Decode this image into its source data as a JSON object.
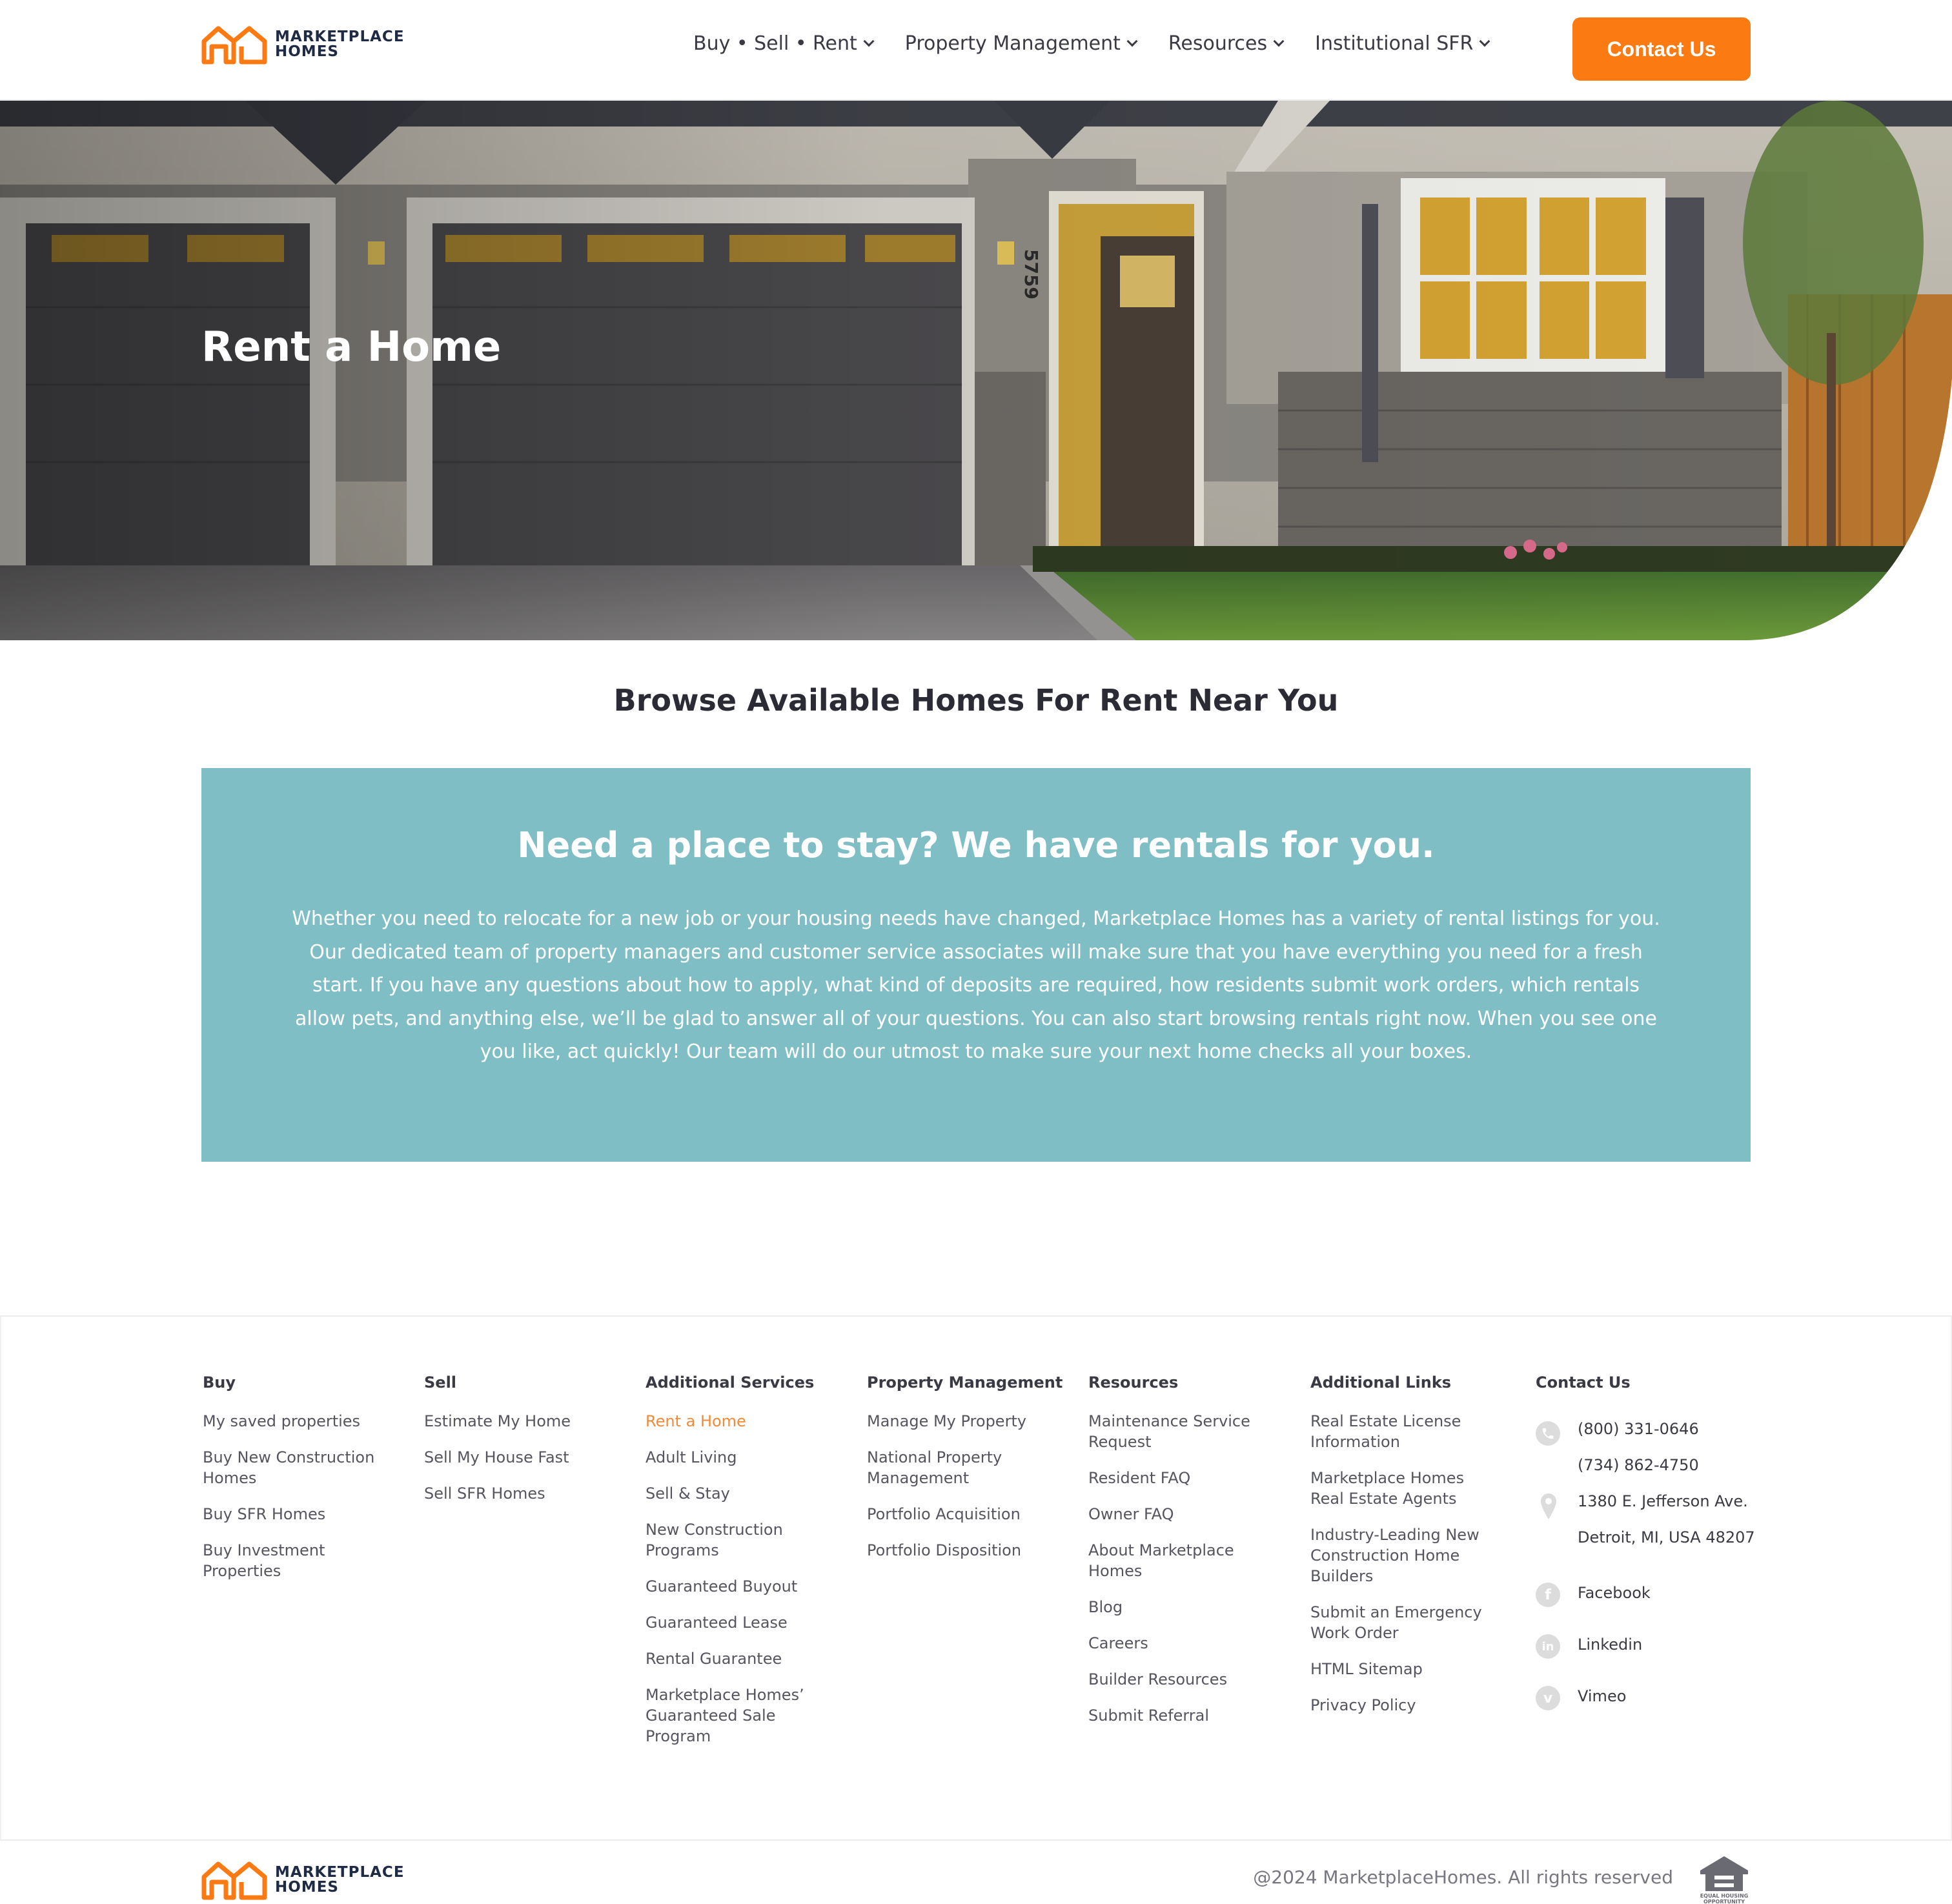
{
  "brand": {
    "line1": "MARKETPLACE",
    "line2": "HOMES",
    "accent": "#fb7a12",
    "navy": "#1f2a44"
  },
  "nav": {
    "items": [
      {
        "label": "Buy • Sell • Rent"
      },
      {
        "label": "Property Management"
      },
      {
        "label": "Resources"
      },
      {
        "label": "Institutional SFR"
      }
    ],
    "cta": "Contact Us"
  },
  "hero": {
    "title": "Rent a Home",
    "house_number": "5759"
  },
  "section": {
    "title": "Browse Available Homes For Rent Near You",
    "box_color": "#7fbec5",
    "box_heading": "Need a place to stay? We have rentals for you.",
    "box_body": "Whether you need to relocate for a new job or your housing needs have changed, Marketplace Homes has a variety of rental listings for you. Our dedicated team of property managers and customer service associates will make sure that you have everything you need for a fresh start. If you have any questions about how to apply, what kind of deposits are required, how residents submit work orders, which rentals allow pets, and anything else, we’ll be glad to answer all of your questions. You can also start browsing rentals right now. When you see one you like, act quickly! Our team will do our utmost to make sure your next home checks all your boxes."
  },
  "footer": {
    "columns": [
      {
        "heading": "Buy",
        "links": [
          "My saved properties",
          "Buy New Construction Homes",
          "Buy SFR Homes",
          "Buy Investment Properties"
        ]
      },
      {
        "heading": "Sell",
        "links": [
          "Estimate My Home",
          "Sell My House Fast",
          "Sell SFR Homes"
        ]
      },
      {
        "heading": "Additional Services",
        "links": [
          "Rent a Home",
          "Adult Living",
          "Sell & Stay",
          "New Construction Programs",
          "Guaranteed Buyout",
          "Guaranteed Lease",
          "Rental Guarantee",
          "Marketplace Homes’ Guaranteed Sale Program"
        ]
      },
      {
        "heading": "Property Management",
        "links": [
          "Manage My Property",
          "National Property Management",
          "Portfolio Acquisition",
          "Portfolio Disposition"
        ]
      },
      {
        "heading": "Resources",
        "links": [
          "Maintenance Service Request",
          "Resident FAQ",
          "Owner FAQ",
          "About Marketplace Homes",
          "Blog",
          "Careers",
          "Builder Resources",
          "Submit Referral"
        ]
      },
      {
        "heading": "Additional Links",
        "links": [
          "Real Estate License Information",
          "Marketplace Homes Real Estate Agents",
          "Industry-Leading New Construction Home Builders",
          "Submit an Emergency Work Order",
          "HTML Sitemap",
          "Privacy Policy"
        ]
      }
    ],
    "active_link": "Rent a Home",
    "contact": {
      "heading": "Contact Us",
      "phone1": "(800) 331-0646",
      "phone2": "(734) 862-4750",
      "address1": "1380 E. Jefferson Ave.",
      "address2": "Detroit, MI, USA 48207",
      "facebook": "Facebook",
      "linkedin": "Linkedin",
      "vimeo": "Vimeo"
    },
    "copyright": "@2024 MarketplaceHomes. All rights reserved",
    "eho_line1": "EQUAL HOUSING",
    "eho_line2": "OPPORTUNITY"
  }
}
